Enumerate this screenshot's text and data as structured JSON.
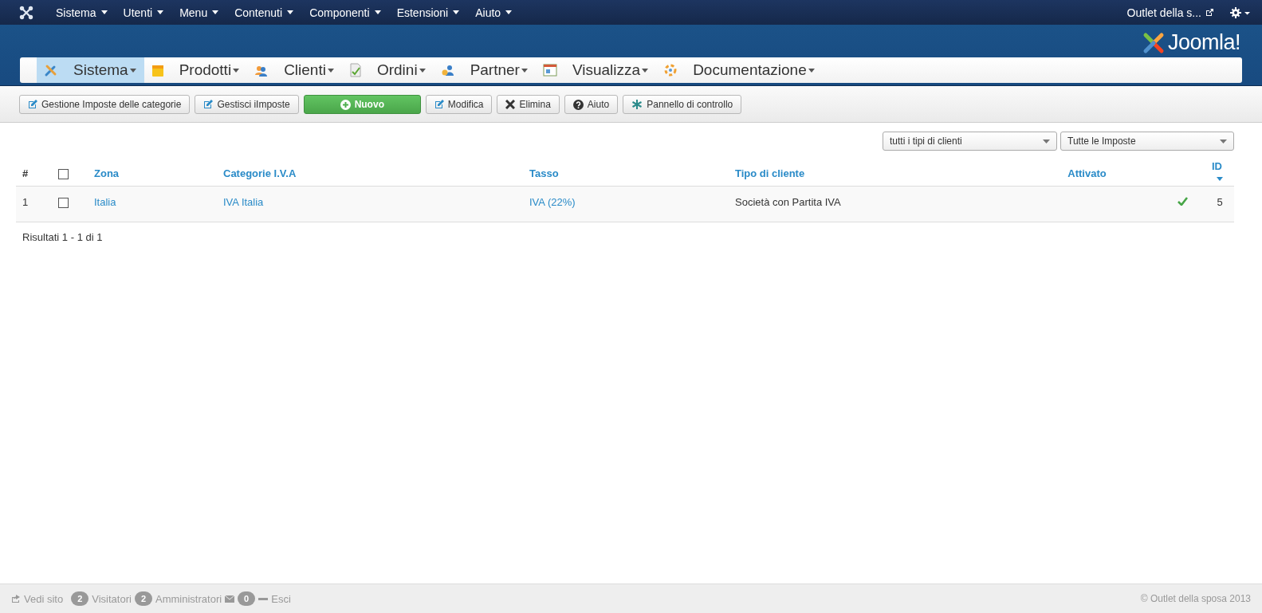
{
  "top_menu": [
    {
      "label": "Sistema"
    },
    {
      "label": "Utenti"
    },
    {
      "label": "Menu"
    },
    {
      "label": "Contenuti"
    },
    {
      "label": "Componenti"
    },
    {
      "label": "Estensioni"
    },
    {
      "label": "Aiuto"
    }
  ],
  "site_link": "Outlet della s...",
  "logo_text": "Joomla!",
  "component_menu": [
    {
      "label": "Sistema",
      "selected": true
    },
    {
      "label": "Prodotti",
      "selected": false
    },
    {
      "label": "Clienti",
      "selected": false
    },
    {
      "label": "Ordini",
      "selected": false
    },
    {
      "label": "Partner",
      "selected": false
    },
    {
      "label": "Visualizza",
      "selected": false
    },
    {
      "label": "Documentazione",
      "selected": false
    }
  ],
  "toolbar": [
    {
      "label": "Gestione Imposte delle categorie",
      "kind": "edit"
    },
    {
      "label": "Gestisci iImposte",
      "kind": "edit"
    },
    {
      "label": "Nuovo",
      "kind": "new"
    },
    {
      "label": "Modifica",
      "kind": "edit"
    },
    {
      "label": "Elimina",
      "kind": "delete"
    },
    {
      "label": "Aiuto",
      "kind": "help"
    },
    {
      "label": "Pannello di controllo",
      "kind": "panel"
    }
  ],
  "filters": [
    {
      "value": "tutti i tipi di clienti"
    },
    {
      "value": "Tutte le Imposte"
    }
  ],
  "table": {
    "select_all_checked": false,
    "columns": [
      "#",
      "Zona",
      "Categorie I.V.A",
      "Tasso",
      "Tipo di cliente",
      "Attivato",
      "ID"
    ],
    "rows": [
      {
        "number": "1",
        "checked": false,
        "zona": "Italia",
        "categoria": "IVA Italia",
        "tasso": "IVA (22%)",
        "tipo": "Società con Partita IVA",
        "activated": true,
        "id": "5"
      }
    ]
  },
  "results": "Risultati 1 - 1 di 1",
  "status_bar": {
    "view_site": "Vedi sito",
    "visitors_count": "2",
    "visitors": "Visitatori",
    "admins_count": "2",
    "admins": "Amministratori",
    "messages_count": "0",
    "logout": "Esci",
    "copyright": "© Outlet della sposa 2013"
  }
}
